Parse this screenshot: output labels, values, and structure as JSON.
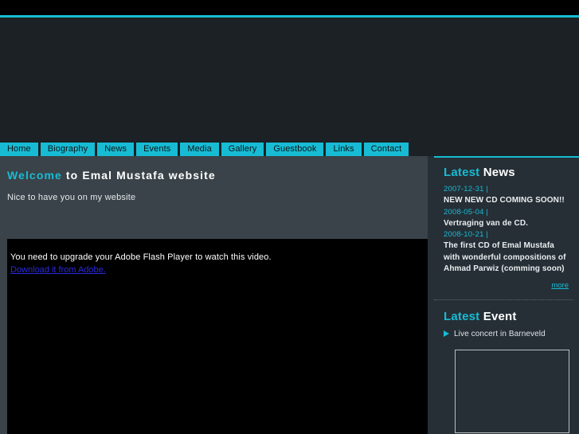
{
  "theme": {
    "accent": "#17bcd4",
    "top_strip": "#000000",
    "banner_bg": "#1b2125",
    "content_bg": "#3a4349",
    "sidebar_bg": "#262f36",
    "link_blue": "#2a2ae0"
  },
  "nav": {
    "items": [
      {
        "label": "Home"
      },
      {
        "label": "Biography"
      },
      {
        "label": "News"
      },
      {
        "label": "Events"
      },
      {
        "label": "Media"
      },
      {
        "label": "Gallery"
      },
      {
        "label": "Guestbook"
      },
      {
        "label": "Links"
      },
      {
        "label": "Contact"
      }
    ]
  },
  "content": {
    "welcome_highlight": "Welcome",
    "welcome_rest": " to Emal Mustafa website",
    "intro": "Nice to have you on my website",
    "video": {
      "message": "You need to upgrade your Adobe Flash Player to watch this video.",
      "link_label": "Download it from Adobe."
    }
  },
  "sidebar": {
    "news": {
      "head_highlight": "Latest",
      "head_rest": " News",
      "items": [
        {
          "date": "2007-12-31 |",
          "title": "NEW NEW CD COMING SOON!!"
        },
        {
          "date": "2008-05-04 |",
          "title": "Vertraging van de CD."
        },
        {
          "date": "2008-10-21 |",
          "title": "The first CD of Emal Mustafa with wonderful compositions of Ahmad Parwiz (comming soon)"
        }
      ],
      "more_label": "more"
    },
    "event": {
      "head_highlight": "Latest",
      "head_rest": " Event",
      "items": [
        {
          "label": "Live concert in Barneveld"
        }
      ]
    }
  }
}
